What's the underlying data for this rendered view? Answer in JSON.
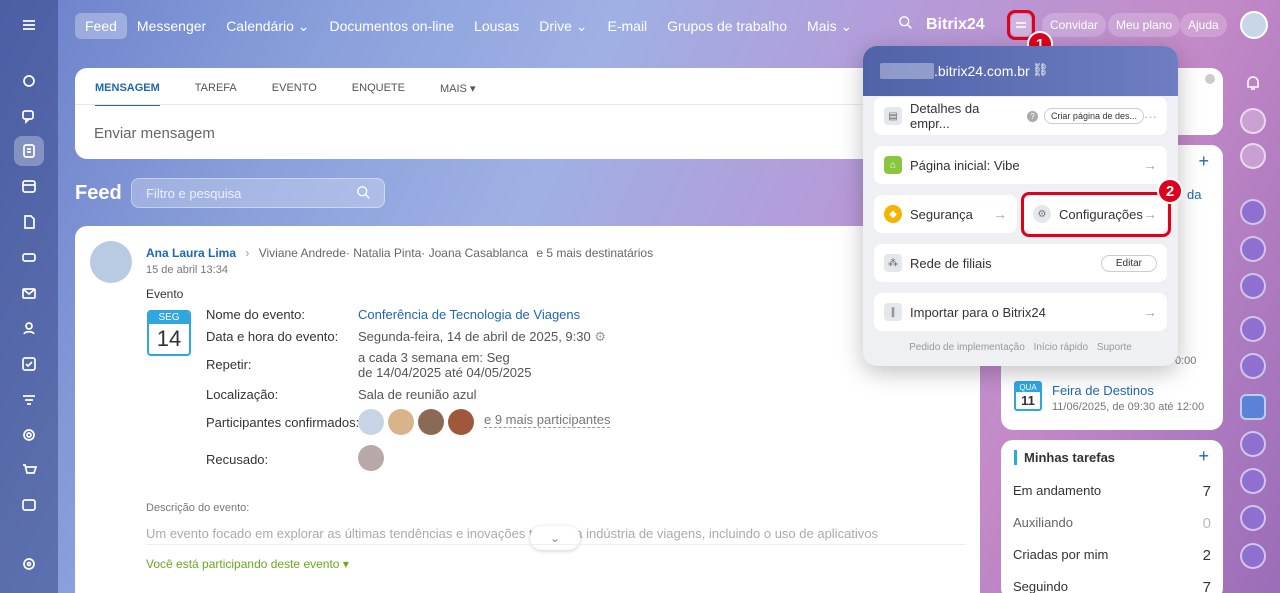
{
  "topnav": {
    "items": [
      "Feed",
      "Messenger",
      "Calendário",
      "Documentos on-line",
      "Lousas",
      "Drive",
      "E-mail",
      "Grupos de trabalho",
      "Mais"
    ],
    "brand": "Bitrix24",
    "brand_suffix": "24",
    "invite": "Convidar",
    "plan": "Meu plano",
    "help": "Ajuda"
  },
  "composer": {
    "tabs": [
      "MENSAGEM",
      "TAREFA",
      "EVENTO",
      "ENQUETE",
      "MAIS"
    ],
    "placeholder": "Enviar mensagem"
  },
  "feed": {
    "title": "Feed",
    "filter_placeholder": "Filtro e pesquisa"
  },
  "post": {
    "author": "Ana Laura Lima",
    "recipients": "Viviane Andrede· Natalia Pinta· Joana Casablanca",
    "more_recipients": "e 5 mais destinatários",
    "date": "15 de abril 13:34",
    "type": "Evento",
    "cal_weekday": "SEG",
    "cal_day": "14",
    "labels": {
      "name": "Nome do evento:",
      "datetime": "Data e hora do evento:",
      "repeat": "Repetir:",
      "location": "Localização:",
      "participants": "Participantes confirmados:",
      "refused": "Recusado:"
    },
    "values": {
      "name": "Conferência de Tecnologia de Viagens",
      "datetime": "Segunda-feira, 14 de abril de 2025, 9:30",
      "repeat_1": "a cada 3 semana em: Seg",
      "repeat_2": "de 14/04/2025 até 04/05/2025",
      "location": "Sala de reunião azul",
      "more_participants": "e 9 mais participantes"
    },
    "desc_label": "Descrição do evento:",
    "desc_text": "Um evento focado em explorar as últimas tendências e inovações tecno... a indústria de viagens, incluindo o uso de aplicativos",
    "participating": "Você está participando deste evento"
  },
  "popup": {
    "domain": ".bitrix24.com.br",
    "company": "Detalhes da empr...",
    "create_page": "Criar página de des...",
    "home": "Página inicial: Vibe",
    "security": "Segurança",
    "settings": "Configurações",
    "branches": "Rede de filiais",
    "edit": "Editar",
    "import": "Importar para o Bitrix24",
    "footer": [
      "Pedido de implementação",
      "Início rápido",
      "Suporte"
    ]
  },
  "right": {
    "event_time_fragment": "0:00",
    "link_fragment": "da",
    "event2_weekday": "QUA",
    "event2_day": "11",
    "event2_title": "Feira de Destinos",
    "event2_time": "11/06/2025, de 09:30 até 12:00",
    "tasks_title": "Minhas tarefas",
    "tasks": [
      {
        "label": "Em andamento",
        "count": "7"
      },
      {
        "label": "Auxiliando",
        "count": "0"
      },
      {
        "label": "Criadas por mim",
        "count": "2"
      },
      {
        "label": "Seguindo",
        "count": "7"
      }
    ]
  },
  "annotations": {
    "step1": "1",
    "step2": "2"
  },
  "colors": {
    "accent": "#2067b0",
    "highlight": "#e0001b",
    "success": "#6aa81e"
  }
}
